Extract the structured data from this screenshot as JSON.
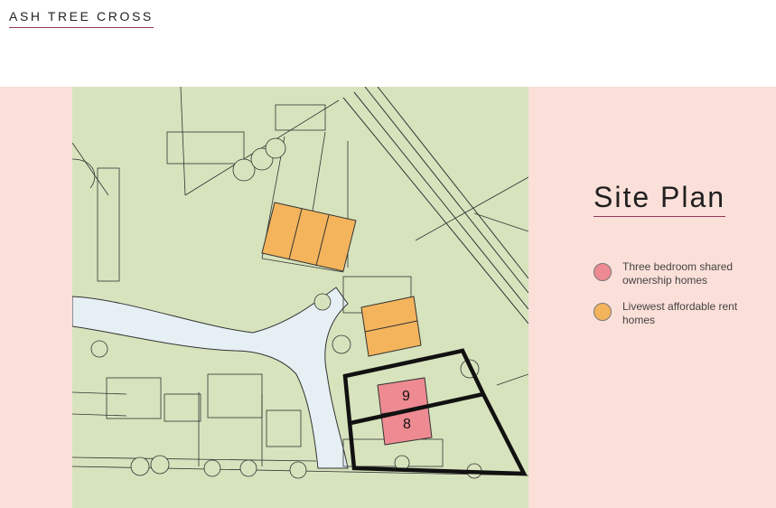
{
  "header": {
    "brand": "ASH TREE CROSS"
  },
  "panel": {
    "title": "Site Plan"
  },
  "legend": [
    {
      "label": "Three bedroom shared ownership homes",
      "color": "#ee8a91"
    },
    {
      "label": "Livewest affordable rent homes",
      "color": "#f4b45c"
    }
  ],
  "plots": [
    {
      "number": "9",
      "type": "shared-ownership"
    },
    {
      "number": "8",
      "type": "shared-ownership"
    }
  ],
  "colors": {
    "background_band": "#fbdfd9",
    "map_ground": "#d7e3bd",
    "road": "#e6f0f4",
    "shared_ownership": "#ee8a91",
    "affordable_rent": "#f4b45c",
    "accent_underline": "#8f3a5a"
  }
}
